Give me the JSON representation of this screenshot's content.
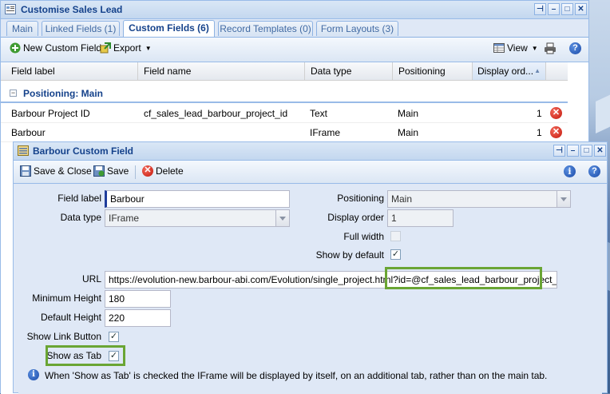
{
  "main_window": {
    "title": "Customise Sales Lead",
    "tabs": [
      {
        "label": "Main"
      },
      {
        "label": "Linked Fields (1)"
      },
      {
        "label": "Custom Fields (6)"
      },
      {
        "label": "Record Templates (0)"
      },
      {
        "label": "Form Layouts (3)"
      }
    ],
    "active_tab": "Custom Fields (6)",
    "toolbar": {
      "new_label": "New Custom Field",
      "export_label": "Export",
      "view_label": "View"
    },
    "grid": {
      "columns": [
        "Field label",
        "Field name",
        "Data type",
        "Positioning",
        "Display ord..."
      ],
      "group_label": "Positioning: Main",
      "rows": [
        {
          "label": "Barbour Project ID",
          "name": "cf_sales_lead_barbour_project_id",
          "type": "Text",
          "positioning": "Main",
          "order": "1"
        },
        {
          "label": "Barbour",
          "name": "",
          "type": "IFrame",
          "positioning": "Main",
          "order": "1"
        }
      ]
    }
  },
  "dialog": {
    "title": "Barbour Custom Field",
    "toolbar": {
      "save_close_label": "Save & Close",
      "save_label": "Save",
      "delete_label": "Delete"
    },
    "form": {
      "field_label_label": "Field label",
      "field_label_value": "Barbour",
      "data_type_label": "Data type",
      "data_type_value": "IFrame",
      "positioning_label": "Positioning",
      "positioning_value": "Main",
      "display_order_label": "Display order",
      "display_order_value": "1",
      "full_width_label": "Full width",
      "show_by_default_label": "Show by default",
      "url_label": "URL",
      "url_prefix": "https://evolution-new.barbour-abi.com/Evolution/single_project.html?id=",
      "url_placeholder_token": "@cf_sales_lead_barbour_project_id@",
      "min_height_label": "Minimum Height",
      "min_height_value": "180",
      "default_height_label": "Default Height",
      "default_height_value": "220",
      "show_link_button_label": "Show Link Button",
      "show_as_tab_label": "Show as Tab",
      "info_text": "When 'Show as Tab' is checked the IFrame will be displayed by itself, on an additional tab, rather than on the main tab."
    },
    "checks": {
      "full_width": false,
      "show_by_default": true,
      "show_link_button": true,
      "show_as_tab": true
    }
  },
  "colors": {
    "highlight_box": "#6aa534",
    "title_text": "#15428b",
    "delete_red": "#c4170b"
  }
}
